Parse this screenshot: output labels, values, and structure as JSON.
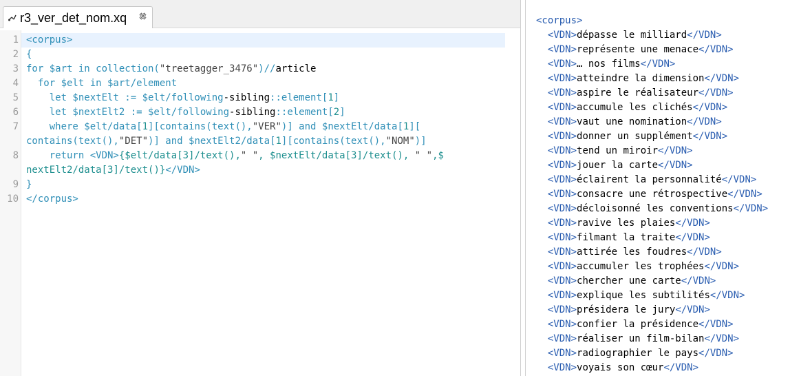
{
  "tab": {
    "title": "r3_ver_det_nom.xq",
    "icon": "xquery-file-icon",
    "close_icon": "close-icon"
  },
  "editor": {
    "line_numbers": [
      "1",
      "2",
      "3",
      "4",
      "5",
      "6",
      "7",
      "",
      "8",
      "",
      "9",
      "10"
    ],
    "lines": [
      [
        {
          "t": "<corpus>",
          "c": "k"
        }
      ],
      [
        {
          "t": "{",
          "c": "k"
        }
      ],
      [
        {
          "t": "for $art in collection(",
          "c": "k"
        },
        {
          "t": "\"treetagger_3476\"",
          "c": "s"
        },
        {
          "t": ")//",
          "c": "k"
        },
        {
          "t": "article",
          "c": "o"
        }
      ],
      [
        {
          "t": "  for $elt in $art/element",
          "c": "k"
        }
      ],
      [
        {
          "t": "    let $nextElt := $elt/following",
          "c": "k"
        },
        {
          "t": "-",
          "c": "o"
        },
        {
          "t": "sibling",
          "c": "o"
        },
        {
          "t": "::element[",
          "c": "k"
        },
        {
          "t": "1",
          "c": "n"
        },
        {
          "t": "]",
          "c": "k"
        }
      ],
      [
        {
          "t": "    let $nextElt2 := $elt/following",
          "c": "k"
        },
        {
          "t": "-",
          "c": "o"
        },
        {
          "t": "sibling",
          "c": "o"
        },
        {
          "t": "::element[",
          "c": "k"
        },
        {
          "t": "2",
          "c": "n"
        },
        {
          "t": "]",
          "c": "k"
        }
      ],
      [
        {
          "t": "    where $elt/data[",
          "c": "k"
        },
        {
          "t": "1",
          "c": "n"
        },
        {
          "t": "][contains(text(),",
          "c": "k"
        },
        {
          "t": "\"VER\"",
          "c": "s"
        },
        {
          "t": ")] and $nextElt/data[",
          "c": "k"
        },
        {
          "t": "1",
          "c": "n"
        },
        {
          "t": "][",
          "c": "k"
        }
      ],
      [
        {
          "t": "contains(text(),",
          "c": "k"
        },
        {
          "t": "\"DET\"",
          "c": "s"
        },
        {
          "t": ")] and $nextElt2/data[",
          "c": "k"
        },
        {
          "t": "1",
          "c": "n"
        },
        {
          "t": "][contains(text(),",
          "c": "k"
        },
        {
          "t": "\"NOM\"",
          "c": "s"
        },
        {
          "t": ")]",
          "c": "k"
        }
      ],
      [
        {
          "t": "    return <VDN>",
          "c": "k"
        },
        {
          "t": "{$elt/data[",
          "c": "n"
        },
        {
          "t": "3",
          "c": "n"
        },
        {
          "t": "]/text(),",
          "c": "n"
        },
        {
          "t": "\" \"",
          "c": "s"
        },
        {
          "t": ", $nextElt/data[",
          "c": "n"
        },
        {
          "t": "3",
          "c": "n"
        },
        {
          "t": "]/text(), ",
          "c": "n"
        },
        {
          "t": "\" \"",
          "c": "s"
        },
        {
          "t": ",$",
          "c": "n"
        }
      ],
      [
        {
          "t": "nextElt2/data[",
          "c": "n"
        },
        {
          "t": "3",
          "c": "n"
        },
        {
          "t": "]/text()}",
          "c": "n"
        },
        {
          "t": "</VDN>",
          "c": "k"
        }
      ],
      [
        {
          "t": "}",
          "c": "k"
        }
      ],
      [
        {
          "t": "</corpus>",
          "c": "k"
        }
      ]
    ]
  },
  "results": {
    "open_tag": "<corpus>",
    "items": [
      "dépasse le milliard",
      "représente une menace",
      "… nos films",
      "atteindre la dimension",
      "aspire le réalisateur",
      "accumule les clichés",
      "vaut une nomination",
      "donner un supplément",
      "tend un miroir",
      "jouer la carte",
      "éclairent la personnalité",
      "consacre une rétrospective",
      "décloisonné les conventions",
      "ravive les plaies",
      "filmant la traite",
      "attirée les foudres",
      "accumuler les trophées",
      "chercher une carte",
      "explique les subtilités",
      "présidera le jury",
      "confier la présidence",
      "réaliser un film-bilan",
      "radiographier le pays",
      "voyais son cœur"
    ],
    "item_open": "<VDN>",
    "item_close": "</VDN>"
  },
  "colors": {
    "keyword": "#2f8fb7",
    "tag": "#2a5db0",
    "current_line": "#e8f2fe"
  }
}
